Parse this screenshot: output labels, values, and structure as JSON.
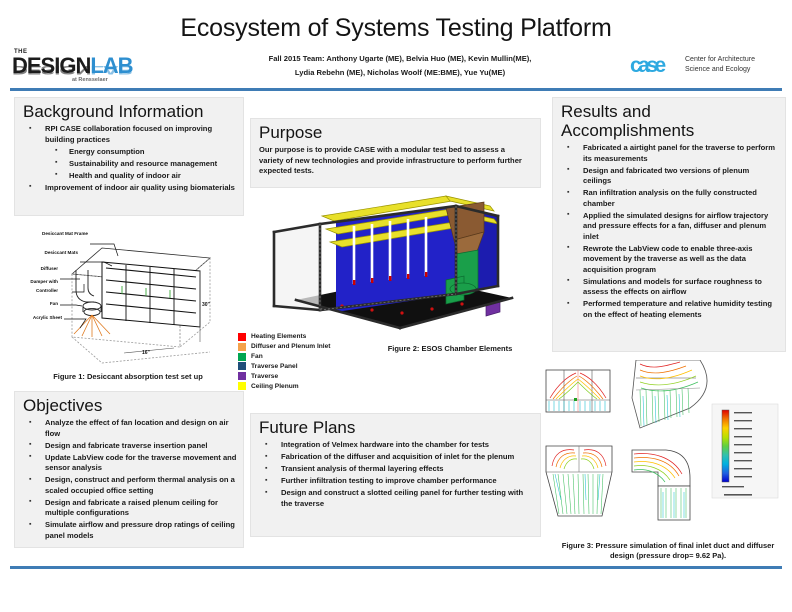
{
  "header": {
    "title": "Ecosystem of Systems Testing Platform",
    "team_line_1": "Fall 2015 Team: Anthony Ugarte (ME), Belvia Huo (ME), Kevin Mullin(ME),",
    "team_line_2": "Lydia Rebehn (ME), Nicholas Woolf (ME:BME), Yue Yu(ME)",
    "designlab_logo": {
      "the": "THE",
      "design": "DESIGN",
      "lab": "LAB",
      "sub": "at Rensselaer"
    },
    "case_logo": {
      "mark": "case",
      "line1": "Center for Architecture",
      "line2": "Science and Ecology"
    },
    "rule_color": "#3f7cb5"
  },
  "background": {
    "title": "Background Information",
    "bullets": [
      {
        "level": 1,
        "text": "RPI CASE collaboration focused on improving building practices"
      },
      {
        "level": 2,
        "text": "Energy consumption"
      },
      {
        "level": 2,
        "text": "Sustainability and resource management"
      },
      {
        "level": 2,
        "text": "Health and quality of indoor air"
      },
      {
        "level": 1,
        "text": "Improvement of indoor air quality using biomaterials"
      }
    ]
  },
  "objectives": {
    "title": "Objectives",
    "bullets": [
      {
        "level": 1,
        "text": "Analyze the effect of fan location and design on air flow"
      },
      {
        "level": 1,
        "text": "Design and fabricate traverse insertion panel"
      },
      {
        "level": 1,
        "text": "Update LabView code for the traverse movement and sensor analysis"
      },
      {
        "level": 1,
        "text": "Design, construct and  perform thermal analysis on a scaled occupied office setting"
      },
      {
        "level": 1,
        "text": "Design and fabricate a raised plenum ceiling for multiple configurations"
      },
      {
        "level": 1,
        "text": "Simulate airflow and pressure drop ratings of ceiling panel models"
      }
    ]
  },
  "purpose": {
    "title": "Purpose",
    "body": "Our purpose is to provide CASE with a modular test bed to assess a variety of new technologies and provide infrastructure to perform further expected tests."
  },
  "future_plans": {
    "title": "Future Plans",
    "bullets": [
      {
        "level": 1,
        "text": "Integration of Velmex hardware into the chamber for tests"
      },
      {
        "level": 1,
        "text": "Fabrication of the diffuser and acquisition of inlet for the plenum"
      },
      {
        "level": 1,
        "text": "Transient analysis of thermal layering effects"
      },
      {
        "level": 1,
        "text": "Further infiltration testing to improve chamber performance"
      },
      {
        "level": 1,
        "text": "Design and construct a slotted ceiling panel for further testing with the traverse"
      }
    ]
  },
  "results": {
    "title_line_1": "Results and",
    "title_line_2": "Accomplishments",
    "bullets": [
      {
        "level": 1,
        "text": "Fabricated a airtight panel for the traverse to perform its measurements"
      },
      {
        "level": 1,
        "text": "Design and fabricated two versions of plenum ceilings"
      },
      {
        "level": 1,
        "text": "Ran infiltration analysis on the fully constructed chamber"
      },
      {
        "level": 1,
        "text": "Applied the simulated designs for airflow trajectory and pressure effects for a fan, diffuser and plenum inlet"
      },
      {
        "level": 1,
        "text": "Rewrote the LabView code to enable three-axis movement by the traverse as well as the data acquisition program"
      },
      {
        "level": 1,
        "text": "Simulations and models for surface roughness to assess the effects on airflow"
      },
      {
        "level": 1,
        "text": "Performed temperature and relative humidity testing on the effect of heating elements"
      }
    ]
  },
  "figure1": {
    "caption": "Figure 1: Desiccant absorption test set up",
    "labels": [
      "Desiccant Mat Frame",
      "Desiccant Mats",
      "Diffuser",
      "Damper with",
      "Controller",
      "Fan",
      "Acrylic Sheet"
    ],
    "dimensions": {
      "height": "30\"",
      "depth": "16\""
    }
  },
  "figure2": {
    "caption": "Figure 2: ESOS Chamber Elements",
    "legend": [
      {
        "label": "Heating Elements",
        "color": "#ff0000"
      },
      {
        "label": "Diffuser and Plenum Inlet",
        "color": "#f5a24b"
      },
      {
        "label": "Fan",
        "color": "#00a651"
      },
      {
        "label": "Traverse Panel",
        "color": "#1f4e79"
      },
      {
        "label": "Traverse",
        "color": "#7030a0"
      },
      {
        "label": "Ceiling Plenum",
        "color": "#ffff00"
      }
    ]
  },
  "figure3": {
    "caption_line_1": "Figure 3: Pressure simulation of final inlet duct and diffuser",
    "caption_line_2": "design (pressure drop= 9.62 Pa).",
    "colorbar_colors": [
      "#e00000",
      "#f07000",
      "#ffd000",
      "#b8e000",
      "#60d040",
      "#30c0b0",
      "#00b0e0",
      "#2060e0",
      "#0000d0"
    ]
  }
}
